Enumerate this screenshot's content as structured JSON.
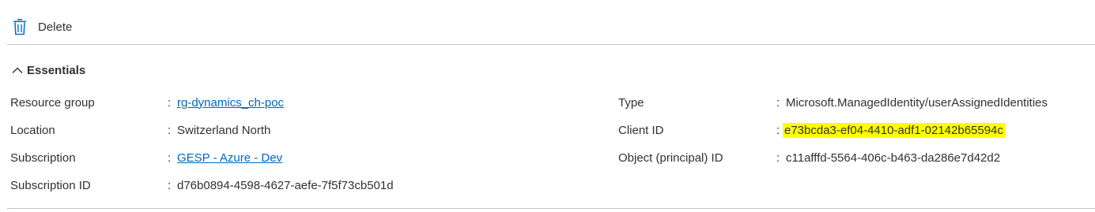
{
  "toolbar": {
    "delete_label": "Delete",
    "delete_icon": "trash-icon"
  },
  "essentials": {
    "title": "Essentials",
    "toggle_icon": "chevron-up-icon",
    "left": [
      {
        "label": "Resource group",
        "value": "rg-dynamics_ch-poc",
        "is_link": true
      },
      {
        "label": "Location",
        "value": "Switzerland North",
        "is_link": false
      },
      {
        "label": "Subscription",
        "value": "GESP - Azure - Dev",
        "is_link": true
      },
      {
        "label": "Subscription ID",
        "value": "d76b0894-4598-4627-aefe-7f5f73cb501d",
        "is_link": false
      }
    ],
    "right": [
      {
        "label": "Type",
        "value": "Microsoft.ManagedIdentity/userAssignedIdentities",
        "highlighted": false
      },
      {
        "label": "Client ID",
        "value": "e73bcda3-ef04-4410-adf1-02142b65594c",
        "highlighted": true
      },
      {
        "label": "Object (principal) ID",
        "value": "c11afffd-5564-406c-b463-da286e7d42d2",
        "highlighted": false
      }
    ],
    "separator": ":"
  },
  "colors": {
    "link": "#0067b8",
    "highlight": "#ffff00",
    "text": "#323130",
    "divider": "#c8c6c4",
    "icon": "#0078d4"
  }
}
